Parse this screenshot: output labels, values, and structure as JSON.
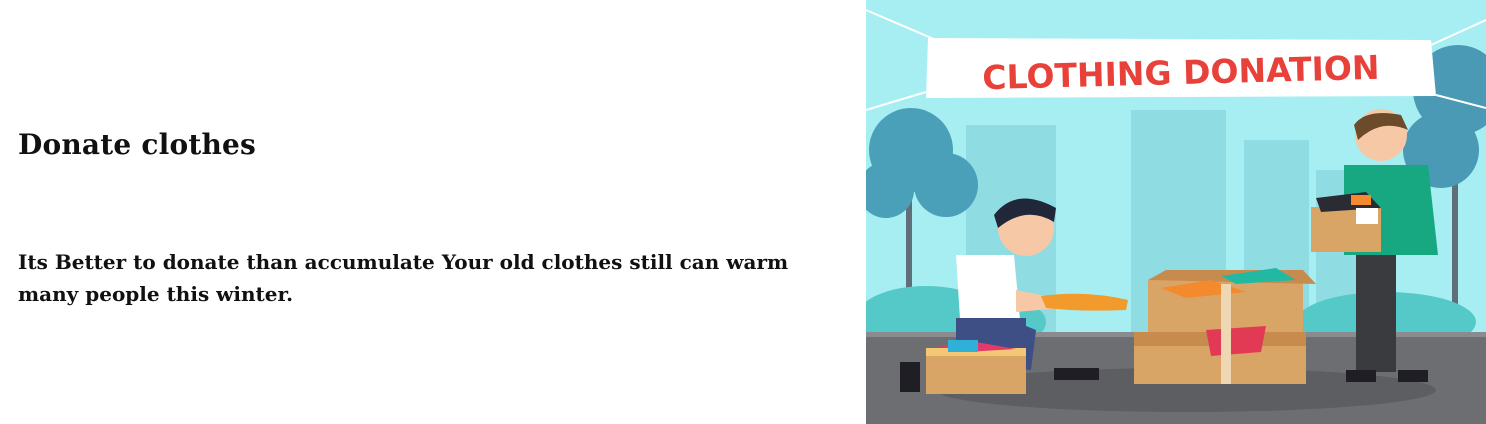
{
  "section": {
    "title": "Donate clothes",
    "description": "Its Better to donate than accumulate Your old clothes still can warm many people this winter."
  },
  "illustration": {
    "banner_text": "CLOTHING DONATION",
    "colors": {
      "sky": "#a6eef2",
      "banner_text": "#e8413a",
      "ground": "#6d6e72",
      "box": "#d9a566"
    }
  }
}
